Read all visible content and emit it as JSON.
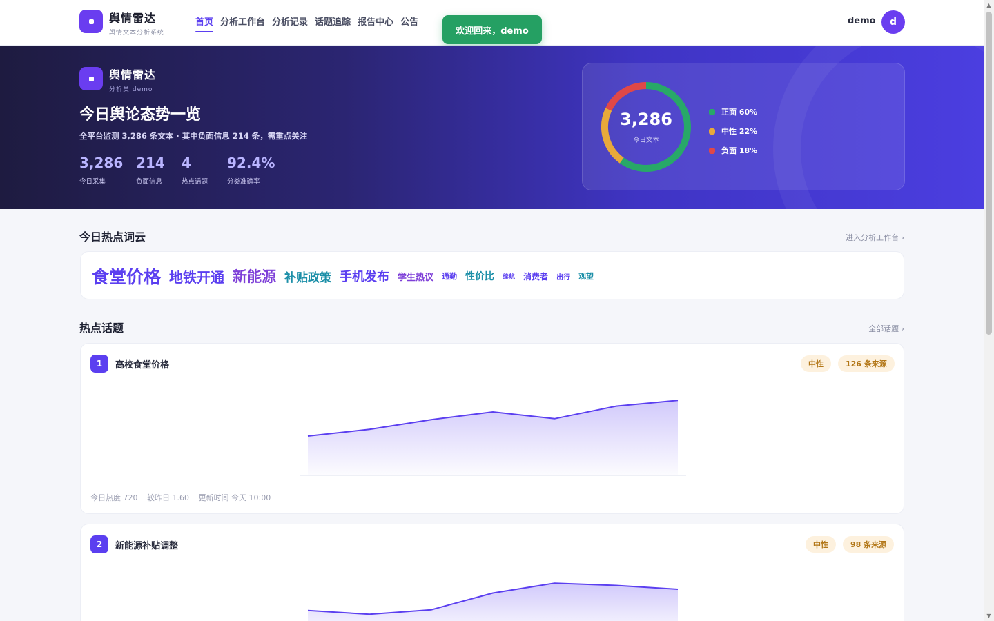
{
  "brand": {
    "name": "舆情雷达",
    "subtitle": "舆情文本分析系统",
    "icon": "radar-logo-icon"
  },
  "nav": {
    "items": [
      "首页",
      "分析工作台",
      "分析记录",
      "话题追踪",
      "报告中心",
      "公告"
    ],
    "active_index": 0
  },
  "toast": "欢迎回来，demo",
  "user": {
    "name": "demo",
    "avatar_letter": "d"
  },
  "hero": {
    "brand": "舆情雷达",
    "role": "分析员 demo",
    "title": "今日舆论态势一览",
    "description": "全平台监测 3,286 条文本 · 其中负面信息 214 条，需重点关注",
    "stats": [
      {
        "value": "3,286",
        "label": "今日采集"
      },
      {
        "value": "214",
        "label": "负面信息"
      },
      {
        "value": "4",
        "label": "热点话题"
      },
      {
        "value": "92.4%",
        "label": "分类准确率"
      }
    ],
    "donut": {
      "total": "3,286",
      "label": "今日文本",
      "segments": [
        {
          "name": "正面",
          "percent": 60,
          "text": "正面 60%",
          "color": "#28a868"
        },
        {
          "name": "中性",
          "percent": 22,
          "text": "中性 22%",
          "color": "#e8a93a"
        },
        {
          "name": "负面",
          "percent": 18,
          "text": "负面 18%",
          "color": "#e04848"
        }
      ]
    }
  },
  "wordcloud": {
    "title": "今日热点词云",
    "link": "进入分析工作台 ›",
    "words": [
      {
        "text": "食堂价格",
        "size": 25,
        "color": "#5b3ff0"
      },
      {
        "text": "地铁开通",
        "size": 20,
        "color": "#5b3ff0"
      },
      {
        "text": "新能源",
        "size": 21,
        "color": "#7e3fd8"
      },
      {
        "text": "补贴政策",
        "size": 17,
        "color": "#1c8fa8"
      },
      {
        "text": "手机发布",
        "size": 18,
        "color": "#5b3ff0"
      },
      {
        "text": "学生热议",
        "size": 13,
        "color": "#7e3fd8"
      },
      {
        "text": "通勤",
        "size": 11,
        "color": "#5b3ff0"
      },
      {
        "text": "性价比",
        "size": 14,
        "color": "#1c8fa8"
      },
      {
        "text": "续航",
        "size": 9,
        "color": "#5b3ff0"
      },
      {
        "text": "消费者",
        "size": 12,
        "color": "#5b3ff0"
      },
      {
        "text": "出行",
        "size": 10,
        "color": "#5b3ff0"
      },
      {
        "text": "观望",
        "size": 11,
        "color": "#1c8fa8"
      }
    ]
  },
  "topics_section": {
    "title": "热点话题",
    "link": "全部话题 ›"
  },
  "topics": [
    {
      "rank": "1",
      "title": "高校食堂价格",
      "sentiment": "中性",
      "sources": "126 条来源",
      "meta": [
        "今日热度 720",
        "较昨日 1.60",
        "更新时间 今天 10:00"
      ],
      "trend": [
        0.4,
        0.47,
        0.57,
        0.65,
        0.58,
        0.71,
        0.77
      ]
    },
    {
      "rank": "2",
      "title": "新能源补贴调整",
      "sentiment": "中性",
      "sources": "98 条来源",
      "meta": [],
      "trend": [
        0.32,
        0.27,
        0.33,
        0.55,
        0.68,
        0.65,
        0.6
      ]
    }
  ]
}
